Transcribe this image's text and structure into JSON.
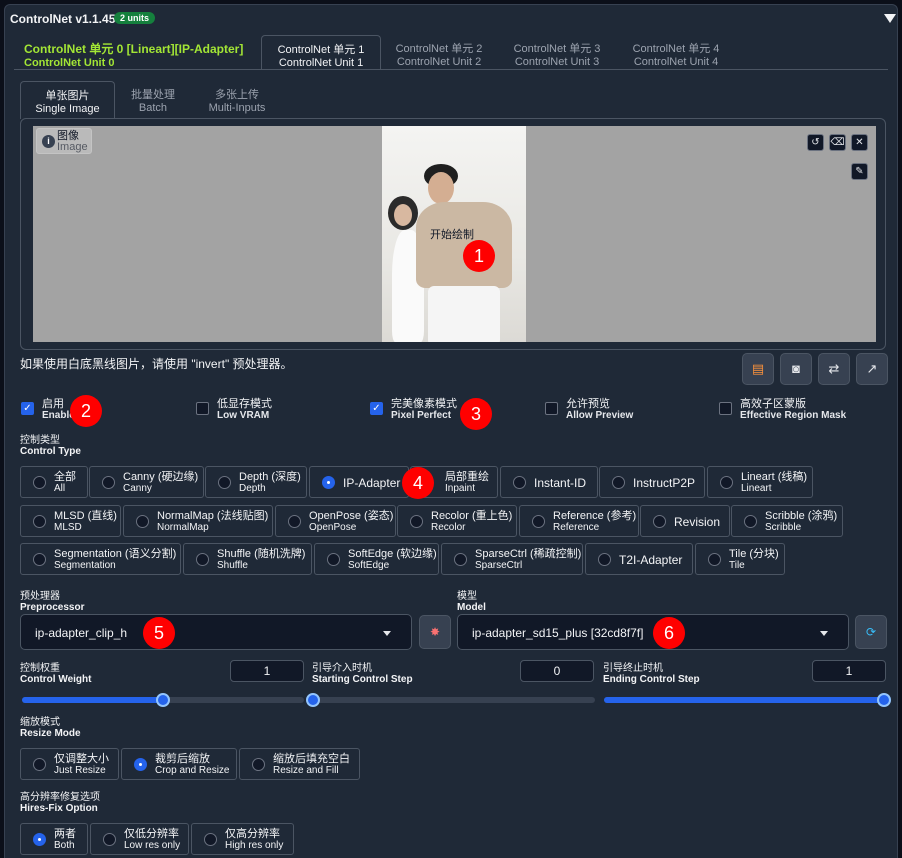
{
  "header": {
    "title": "ControlNet v1.1.455",
    "badge": "2 units"
  },
  "unit_tabs": [
    {
      "zh": "ControlNet 单元 0 [Lineart][IP-Adapter]",
      "en": "ControlNet Unit 0"
    },
    {
      "zh": "ControlNet 单元 1",
      "en": "ControlNet Unit 1"
    },
    {
      "zh": "ControlNet 单元 2",
      "en": "ControlNet Unit 2"
    },
    {
      "zh": "ControlNet 单元 3",
      "en": "ControlNet Unit 3"
    },
    {
      "zh": "ControlNet 单元 4",
      "en": "ControlNet Unit 4"
    }
  ],
  "input_tabs": [
    {
      "zh": "单张图片",
      "en": "Single Image"
    },
    {
      "zh": "批量处理",
      "en": "Batch"
    },
    {
      "zh": "多张上传",
      "en": "Multi-Inputs"
    }
  ],
  "image": {
    "label_zh": "图像",
    "label_en": "Image",
    "start_draw": "开始绘制"
  },
  "hint": "如果使用白底黑线图片，请使用 \"invert\" 预处理器。",
  "checkboxes": [
    {
      "zh": "启用",
      "en": "Enable",
      "checked": true
    },
    {
      "zh": "低显存模式",
      "en": "Low VRAM",
      "checked": false
    },
    {
      "zh": "完美像素模式",
      "en": "Pixel Perfect",
      "checked": true
    },
    {
      "zh": "允许预览",
      "en": "Allow Preview",
      "checked": false
    },
    {
      "zh": "高效子区蒙版",
      "en": "Effective Region Mask",
      "checked": false
    }
  ],
  "control_type": {
    "label_zh": "控制类型",
    "label_en": "Control Type",
    "options": [
      {
        "zh": "全部",
        "en": "All"
      },
      {
        "zh": "Canny (硬边缘)",
        "en": "Canny"
      },
      {
        "zh": "Depth (深度)",
        "en": "Depth"
      },
      {
        "single": "IP-Adapter",
        "selected": true
      },
      {
        "zh": "局部重绘",
        "en": "Inpaint"
      },
      {
        "single": "Instant-ID"
      },
      {
        "single": "InstructP2P"
      },
      {
        "zh": "Lineart (线稿)",
        "en": "Lineart"
      },
      {
        "zh": "MLSD (直线)",
        "en": "MLSD"
      },
      {
        "zh": "NormalMap (法线贴图)",
        "en": "NormalMap"
      },
      {
        "zh": "OpenPose (姿态)",
        "en": "OpenPose"
      },
      {
        "zh": "Recolor (重上色)",
        "en": "Recolor"
      },
      {
        "zh": "Reference (参考)",
        "en": "Reference"
      },
      {
        "single": "Revision"
      },
      {
        "zh": "Scribble (涂鸦)",
        "en": "Scribble"
      },
      {
        "zh": "Segmentation (语义分割)",
        "en": "Segmentation"
      },
      {
        "zh": "Shuffle (随机洗牌)",
        "en": "Shuffle"
      },
      {
        "zh": "SoftEdge (软边缘)",
        "en": "SoftEdge"
      },
      {
        "zh": "SparseCtrl (稀疏控制)",
        "en": "SparseCtrl"
      },
      {
        "single": "T2I-Adapter"
      },
      {
        "zh": "Tile (分块)",
        "en": "Tile"
      }
    ]
  },
  "preprocessor": {
    "label_zh": "预处理器",
    "label_en": "Preprocessor",
    "value": "ip-adapter_clip_h"
  },
  "model": {
    "label_zh": "模型",
    "label_en": "Model",
    "value": "ip-adapter_sd15_plus [32cd8f7f]"
  },
  "sliders": [
    {
      "zh": "控制权重",
      "en": "Control Weight",
      "value": "1",
      "fraction": 0.5
    },
    {
      "zh": "引导介入时机",
      "en": "Starting Control Step",
      "value": "0",
      "fraction": 0.0
    },
    {
      "zh": "引导终止时机",
      "en": "Ending Control Step",
      "value": "1",
      "fraction": 1.0
    }
  ],
  "resize_mode": {
    "label_zh": "缩放模式",
    "label_en": "Resize Mode",
    "options": [
      {
        "zh": "仅调整大小",
        "en": "Just Resize"
      },
      {
        "zh": "裁剪后缩放",
        "en": "Crop and Resize",
        "selected": true
      },
      {
        "zh": "缩放后填充空白",
        "en": "Resize and Fill"
      }
    ]
  },
  "hires_fix": {
    "label_zh": "高分辨率修复选项",
    "label_en": "Hires-Fix Option",
    "options": [
      {
        "zh": "两者",
        "en": "Both",
        "selected": true
      },
      {
        "zh": "仅低分辨率",
        "en": "Low res only"
      },
      {
        "zh": "仅高分辨率",
        "en": "High res only"
      }
    ]
  },
  "markers": [
    "1",
    "2",
    "3",
    "4",
    "5",
    "6"
  ]
}
